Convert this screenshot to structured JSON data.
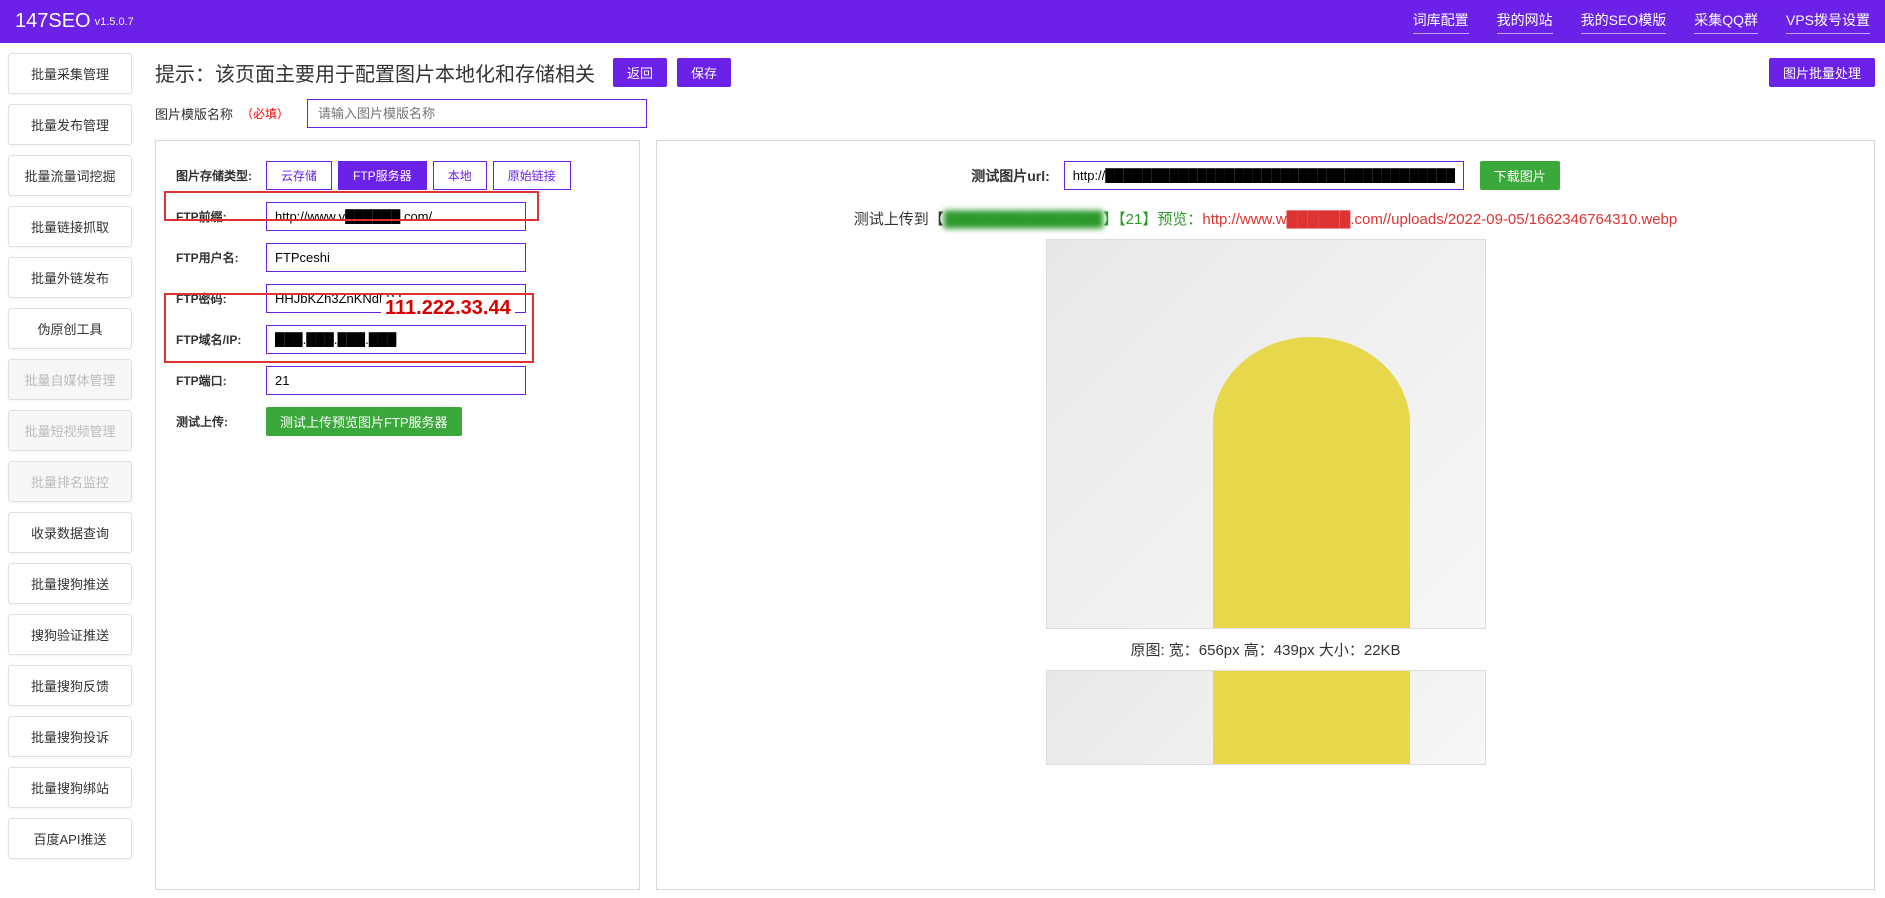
{
  "header": {
    "brand": "147SEO",
    "version": "v1.5.0.7",
    "nav": [
      "词库配置",
      "我的网站",
      "我的SEO模版",
      "采集QQ群",
      "VPS拨号设置"
    ]
  },
  "sidebar": [
    {
      "label": "批量采集管理",
      "disabled": false
    },
    {
      "label": "批量发布管理",
      "disabled": false
    },
    {
      "label": "批量流量词挖掘",
      "disabled": false
    },
    {
      "label": "批量链接抓取",
      "disabled": false
    },
    {
      "label": "批量外链发布",
      "disabled": false
    },
    {
      "label": "伪原创工具",
      "disabled": false
    },
    {
      "label": "批量自媒体管理",
      "disabled": true
    },
    {
      "label": "批量短视频管理",
      "disabled": true
    },
    {
      "label": "批量排名监控",
      "disabled": true
    },
    {
      "label": "收录数据查询",
      "disabled": false
    },
    {
      "label": "批量搜狗推送",
      "disabled": false
    },
    {
      "label": "搜狗验证推送",
      "disabled": false
    },
    {
      "label": "批量搜狗反馈",
      "disabled": false
    },
    {
      "label": "批量搜狗投诉",
      "disabled": false
    },
    {
      "label": "批量搜狗绑站",
      "disabled": false
    },
    {
      "label": "百度API推送",
      "disabled": false
    }
  ],
  "page": {
    "title": "提示：该页面主要用于配置图片本地化和存储相关",
    "btn_back": "返回",
    "btn_save": "保存",
    "btn_batch": "图片批量处理",
    "tpl_name_label": "图片模版名称",
    "required": "（必填）",
    "tpl_name_placeholder": "请输入图片模版名称"
  },
  "form": {
    "storage_type_label": "图片存储类型:",
    "storage_options": [
      "云存储",
      "FTP服务器",
      "本地",
      "原始链接"
    ],
    "storage_selected": 1,
    "ftp_prefix_label": "FTP前缀:",
    "ftp_prefix_value": "http://www.v██████.com/",
    "ftp_user_label": "FTP用户名:",
    "ftp_user_value": "FTPceshi",
    "ftp_pass_label": "FTP密码:",
    "ftp_pass_value": "HHJbKZh3ZnKNdLBJ",
    "ftp_host_label": "FTP域名/IP:",
    "ftp_host_value": "███.███.███.███",
    "overlay_ip": "111.222.33.44",
    "ftp_port_label": "FTP端口:",
    "ftp_port_value": "21",
    "test_upload_label": "测试上传:",
    "test_upload_btn": "测试上传预览图片FTP服务器"
  },
  "preview": {
    "test_url_label": "测试图片url:",
    "test_url_value": "http://██████████████████████████████████████████.jpg",
    "download_btn": "下载图片",
    "result_prefix": "测试上传到【",
    "result_host": "███████████████",
    "result_mid": "】【21】预览：",
    "result_link": "http://www.w██████.com//uploads/2022-09-05/1662346764310.webp",
    "info_line": "原图: 宽：656px 高：439px 大小：22KB"
  }
}
